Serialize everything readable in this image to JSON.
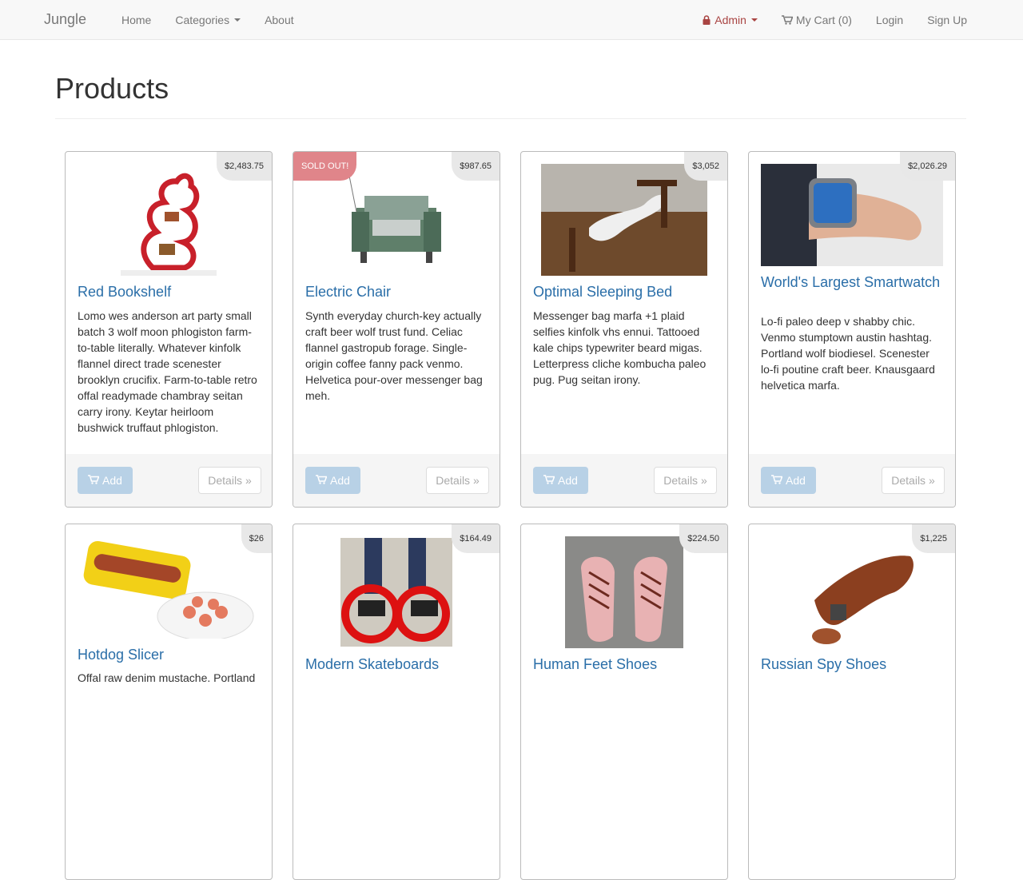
{
  "nav": {
    "brand": "Jungle",
    "home": "Home",
    "categories": "Categories",
    "about": "About",
    "admin": "Admin",
    "cart": "My Cart (0)",
    "login": "Login",
    "signup": "Sign Up"
  },
  "page": {
    "title": "Products"
  },
  "labels": {
    "add": "Add",
    "details": "Details »",
    "sold_out": "SOLD OUT!"
  },
  "colors": {
    "link": "#2a6ea8",
    "admin": "#a94442",
    "add_button": "#b8d1e6",
    "sold_out": "#e0858a"
  },
  "products": [
    {
      "name": "Red Bookshelf",
      "price": "$2,483.75",
      "sold_out": false,
      "icon": "red-bookshelf-image",
      "description": "Lomo wes anderson art party small batch 3 wolf moon phlogiston farm-to-table literally. Whatever kinfolk flannel direct trade scenester brooklyn crucifix. Farm-to-table retro offal readymade chambray seitan carry irony. Keytar heirloom bushwick truffaut phlogiston."
    },
    {
      "name": "Electric Chair",
      "price": "$987.65",
      "sold_out": true,
      "icon": "electric-chair-image",
      "description": "Synth everyday church-key actually craft beer wolf trust fund. Celiac flannel gastropub forage. Single-origin coffee fanny pack venmo. Helvetica pour-over messenger bag meh."
    },
    {
      "name": "Optimal Sleeping Bed",
      "price": "$3,052",
      "sold_out": false,
      "icon": "sleeping-bed-image",
      "description": "Messenger bag marfa +1 plaid selfies kinfolk vhs ennui. Tattooed kale chips typewriter beard migas. Letterpress cliche kombucha paleo pug. Pug seitan irony."
    },
    {
      "name": "World's Largest Smartwatch",
      "price": "$2,026.29",
      "sold_out": false,
      "icon": "smartwatch-image",
      "description": "Lo-fi paleo deep v shabby chic. Venmo stumptown austin hashtag. Portland wolf biodiesel. Scenester lo-fi poutine craft beer. Knausgaard helvetica marfa."
    },
    {
      "name": "Hotdog Slicer",
      "price": "$26",
      "sold_out": false,
      "icon": "hotdog-slicer-image",
      "description": "Offal raw denim mustache. Portland"
    },
    {
      "name": "Modern Skateboards",
      "price": "$164.49",
      "sold_out": false,
      "icon": "skateboards-image",
      "description": ""
    },
    {
      "name": "Human Feet Shoes",
      "price": "$224.50",
      "sold_out": false,
      "icon": "feet-shoes-image",
      "description": ""
    },
    {
      "name": "Russian Spy Shoes",
      "price": "$1,225",
      "sold_out": false,
      "icon": "spy-shoes-image",
      "description": ""
    }
  ]
}
